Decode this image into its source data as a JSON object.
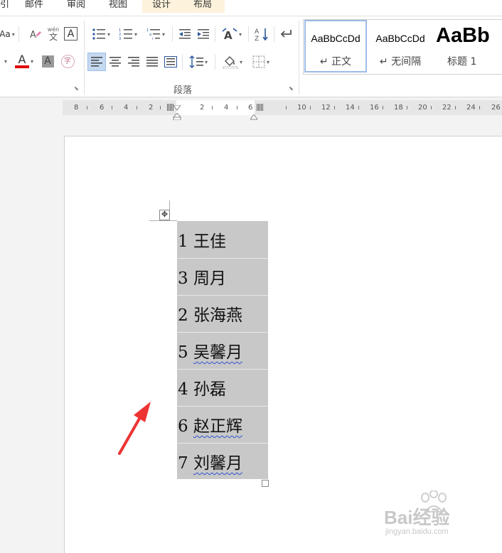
{
  "ribbon_tabs": {
    "view_partial": "引",
    "mailings": "邮件",
    "review": "审阅",
    "view": "视图",
    "design": "设计",
    "layout": "布局"
  },
  "font_group": {
    "font_size_partial": "Aa",
    "phonetic_top": "wén",
    "phonetic_char": "文",
    "border_char": "A",
    "font_color": "A",
    "char_shading": "A",
    "enclose_char": "字",
    "font_color_value": "#e00000"
  },
  "paragraph_group": {
    "label": "段落"
  },
  "styles_gallery": {
    "items": [
      {
        "preview": "AaBbCcDd",
        "name": "↵ 正文",
        "selected": true
      },
      {
        "preview": "AaBbCcDd",
        "name": "↵ 无间隔",
        "selected": false
      },
      {
        "preview": "AaBb",
        "name": "标题 1",
        "selected": false
      }
    ]
  },
  "ruler": {
    "labels": [
      "8",
      "6",
      "4",
      "2",
      "2",
      "4",
      "6",
      "10",
      "12",
      "14",
      "16",
      "18",
      "20",
      "22",
      "24",
      "26"
    ]
  },
  "table": {
    "rows": [
      {
        "num": "1",
        "name": "王佳",
        "spell_error": false
      },
      {
        "num": "3",
        "name": "周月",
        "spell_error": false
      },
      {
        "num": "2",
        "name": "张海燕",
        "spell_error": false
      },
      {
        "num": "5",
        "name": "吴馨月",
        "spell_error": true
      },
      {
        "num": "4",
        "name": "孙磊",
        "spell_error": false
      },
      {
        "num": "6",
        "name": "赵正辉",
        "spell_error": true
      },
      {
        "num": "7",
        "name": "刘馨月",
        "spell_error": true
      }
    ]
  },
  "watermark": {
    "brand": "Bai经验",
    "url": "jingyan.baidu.com"
  },
  "colors": {
    "accent": "#2b579a",
    "selection": "#c8c8c8",
    "arrow": "#ee3333"
  }
}
